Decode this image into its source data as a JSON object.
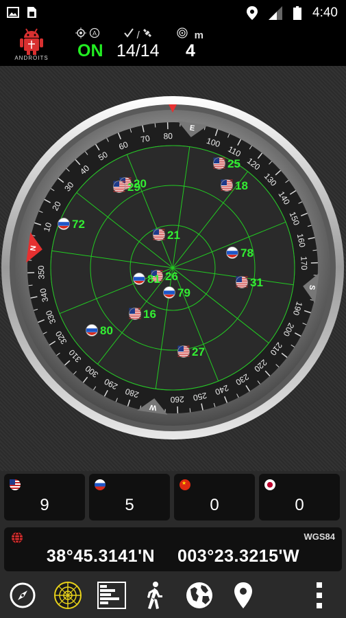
{
  "status_bar": {
    "time": "4:40",
    "left_icons": [
      "image-icon",
      "sim-card-icon"
    ],
    "right_icons": [
      "location-pin-icon",
      "signal-icon",
      "battery-icon"
    ]
  },
  "header": {
    "logo_text": "ANDROITS",
    "gps_state": "ON",
    "satellites_used": "14",
    "satellites_visible": "14",
    "separator": "/",
    "accuracy": "4",
    "accuracy_unit": "m",
    "state_color": "#22ee22"
  },
  "compass": {
    "cardinals": {
      "north": "N",
      "east": "E",
      "south": "S",
      "west": "W"
    },
    "accent_color": "#e53030",
    "grid_color": "#22cc22",
    "label_color": "#33ee33"
  },
  "satellites": [
    {
      "id": "25",
      "flag": "us"
    },
    {
      "id": "18",
      "flag": "us"
    },
    {
      "id": "20",
      "flag": "us"
    },
    {
      "id": "29",
      "flag": "us"
    },
    {
      "id": "72",
      "flag": "ru"
    },
    {
      "id": "21",
      "flag": "us"
    },
    {
      "id": "78",
      "flag": "ru"
    },
    {
      "id": "26",
      "flag": "us"
    },
    {
      "id": "81",
      "flag": "ru"
    },
    {
      "id": "31",
      "flag": "us"
    },
    {
      "id": "79",
      "flag": "ru"
    },
    {
      "id": "16",
      "flag": "us"
    },
    {
      "id": "80",
      "flag": "ru"
    },
    {
      "id": "27",
      "flag": "us"
    }
  ],
  "counts": [
    {
      "system": "us",
      "count": "9"
    },
    {
      "system": "ru",
      "count": "5"
    },
    {
      "system": "cn",
      "count": "0"
    },
    {
      "system": "jp",
      "count": "0"
    }
  ],
  "location": {
    "datum": "WGS84",
    "latitude": "38°45.3141'N",
    "longitude": "003°23.3215'W"
  },
  "nav": [
    "compass-icon",
    "radar-icon",
    "signal-bars-icon",
    "walking-person-icon",
    "globe-icon",
    "map-pin-icon",
    "more-vertical-icon"
  ]
}
